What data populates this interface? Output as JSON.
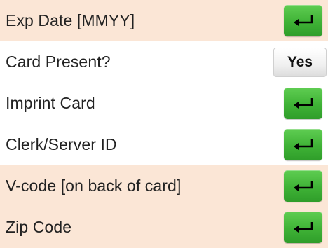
{
  "rows": [
    {
      "label": "Exp Date [MMYY]",
      "shaded": true,
      "control": "enter",
      "control_icon": "enter-return-icon"
    },
    {
      "label": "Card Present?",
      "shaded": false,
      "control": "toggle",
      "value": "Yes"
    },
    {
      "label": "Imprint Card",
      "shaded": false,
      "control": "enter",
      "control_icon": "enter-return-icon"
    },
    {
      "label": "Clerk/Server ID",
      "shaded": false,
      "control": "enter",
      "control_icon": "enter-return-icon"
    },
    {
      "label": "V-code [on back of card]",
      "shaded": true,
      "control": "enter",
      "control_icon": "enter-return-icon"
    },
    {
      "label": "Zip Code",
      "shaded": true,
      "control": "enter",
      "control_icon": "enter-return-icon"
    }
  ],
  "colors": {
    "shaded_row": "#fbe6d6",
    "plain_row": "#ffffff",
    "enter_button": "#3fb236"
  }
}
